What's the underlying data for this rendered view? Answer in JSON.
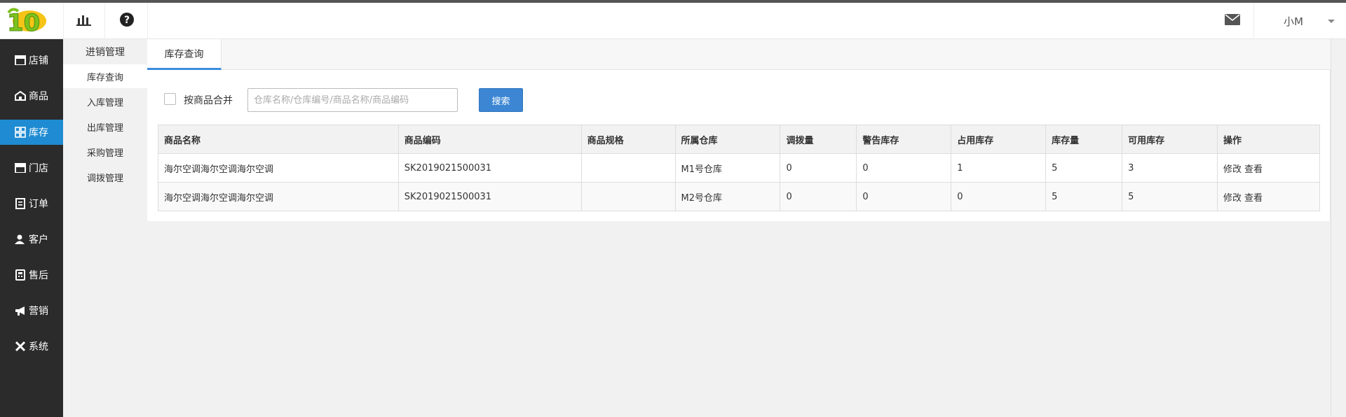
{
  "header": {
    "user_name": "小M"
  },
  "sidebar": {
    "items": [
      {
        "label": "店铺",
        "icon": "shop-icon"
      },
      {
        "label": "商品",
        "icon": "goods-icon"
      },
      {
        "label": "库存",
        "icon": "grid-icon"
      },
      {
        "label": "门店",
        "icon": "store-icon"
      },
      {
        "label": "订单",
        "icon": "order-icon"
      },
      {
        "label": "客户",
        "icon": "user-icon"
      },
      {
        "label": "售后",
        "icon": "aftersale-icon"
      },
      {
        "label": "营销",
        "icon": "megaphone-icon"
      },
      {
        "label": "系统",
        "icon": "tools-icon"
      }
    ],
    "active_index": 2
  },
  "subnav": {
    "title": "进销管理",
    "items": [
      "库存查询",
      "入库管理",
      "出库管理",
      "采购管理",
      "调拨管理"
    ],
    "active_index": 0
  },
  "tabs": [
    "库存查询"
  ],
  "filter": {
    "merge_label": "按商品合并",
    "search_placeholder": "仓库名称/仓库编号/商品名称/商品编码",
    "search_button": "搜索"
  },
  "table": {
    "columns": [
      "商品名称",
      "商品编码",
      "商品规格",
      "所属仓库",
      "调拨量",
      "警告库存",
      "占用库存",
      "库存量",
      "可用库存",
      "操作"
    ],
    "rows": [
      {
        "name": "海尔空调海尔空调海尔空调",
        "code": "SK2019021500031",
        "spec": "",
        "warehouse": "M1号仓库",
        "transfer": "0",
        "warning": "0",
        "occupied": "1",
        "stock": "5",
        "available": "3",
        "op_edit": "修改",
        "op_view": "查看"
      },
      {
        "name": "海尔空调海尔空调海尔空调",
        "code": "SK2019021500031",
        "spec": "",
        "warehouse": "M2号仓库",
        "transfer": "0",
        "warning": "0",
        "occupied": "0",
        "stock": "5",
        "available": "5",
        "op_edit": "修改",
        "op_view": "查看"
      }
    ]
  },
  "colors": {
    "sidebar_bg": "#2b2b2b",
    "active_blue": "#1f8bd2",
    "button_blue": "#3c86d4",
    "logo_green": "#7dc21e",
    "logo_yellow": "#f6c416"
  }
}
